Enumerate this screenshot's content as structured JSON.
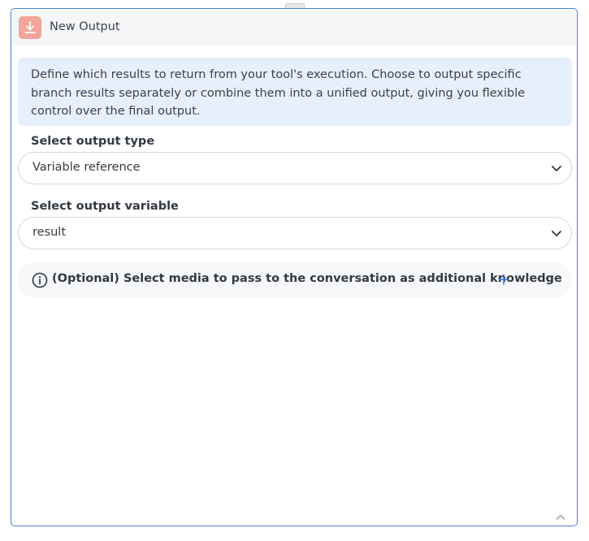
{
  "node": {
    "title": "New Output",
    "icon": "download-icon",
    "accent_color": "#f1a59c",
    "border_color": "#4a7fd6"
  },
  "info": {
    "text": "Define which results to return from your tool's execution. Choose to output specific branch results separately or combine them into a unified output, giving you flexible control over the final output."
  },
  "output_type": {
    "label": "Select output type",
    "value": "Variable reference"
  },
  "output_variable": {
    "label": "Select output variable",
    "value": "result"
  },
  "media": {
    "text": "(Optional) Select media to pass to the conversation as additional knowledge",
    "info_icon": "info-circle-icon",
    "add_icon": "plus-icon",
    "add_color": "#3b7be0"
  },
  "footer": {
    "collapse_icon": "chevron-up-icon"
  }
}
